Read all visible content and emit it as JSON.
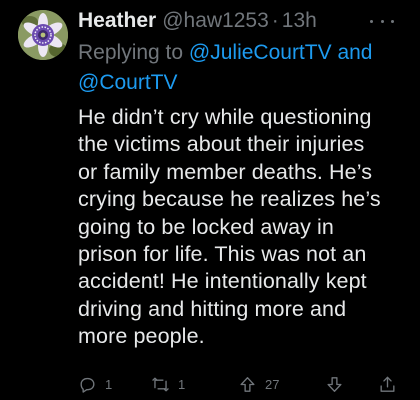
{
  "tweet": {
    "display_name": "Heather",
    "handle": "@haw1253",
    "separator": "·",
    "time": "13h",
    "replying_prefix": "Replying to ",
    "replying_mention_1": "@JulieCourtTV",
    "replying_joiner": " and",
    "replying_mention_2": "@CourtTV",
    "text": "He didn’t cry while questioning\nthe victims about their injuries\nor family member deaths. He’s\ncrying because he realizes he’s\ngoing to be locked away in\nprison for life. This was not an\naccident! He intentionally kept\ndriving and hitting more and\nmore people."
  },
  "actions": {
    "reply_count": "1",
    "retweet_count": "1",
    "like_count": "27"
  },
  "icons": {
    "avatar": "passion-flower-avatar",
    "more": "more-dots-icon",
    "reply": "reply-bubble-icon",
    "retweet": "retweet-icon",
    "like": "up-arrow-icon",
    "down": "down-arrow-icon",
    "share": "share-icon"
  },
  "colors": {
    "background": "#000000",
    "text": "#e7e9ea",
    "secondary": "#71767b",
    "accent": "#1d9bf0"
  }
}
